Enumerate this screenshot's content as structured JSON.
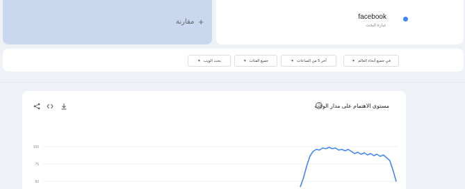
{
  "compare": {
    "label": "مقارنة",
    "plus": "+"
  },
  "term": {
    "name": "facebook",
    "subtitle": "عبارة البحث",
    "color": "#4285f4"
  },
  "filters": [
    {
      "label": "في جميع أنحاء العالم"
    },
    {
      "label": "آخر 5 من الساعات"
    },
    {
      "label": "جميع الفئات"
    },
    {
      "label": "بحث الويب"
    }
  ],
  "chart_panel": {
    "title": "مستوى الاهتمام على مدار الوقت",
    "help": "?",
    "icons": [
      "share-icon",
      "embed-icon",
      "download-icon"
    ]
  },
  "chart_data": {
    "type": "line",
    "title": "مستوى الاهتمام على مدار الوقت",
    "xlabel": "",
    "ylabel": "",
    "yticks": [
      "100",
      "75",
      "50"
    ],
    "ylim": [
      0,
      100
    ],
    "x": [
      0,
      1,
      2,
      3,
      4,
      5,
      6,
      7,
      8,
      9,
      10,
      11,
      12,
      13,
      14,
      15,
      16,
      17,
      18,
      19,
      20,
      21,
      22,
      23,
      24,
      25,
      26,
      27,
      28,
      29,
      30
    ],
    "series": [
      {
        "values": [
          42,
          55,
          72,
          86,
          93,
          96,
          95,
          98,
          97,
          99,
          97,
          98,
          95,
          96,
          94,
          96,
          93,
          90,
          92,
          89,
          91,
          88,
          90,
          87,
          89,
          86,
          88,
          84,
          80,
          66,
          50
        ]
      }
    ],
    "line_color": "#4285f4",
    "grid": true
  }
}
